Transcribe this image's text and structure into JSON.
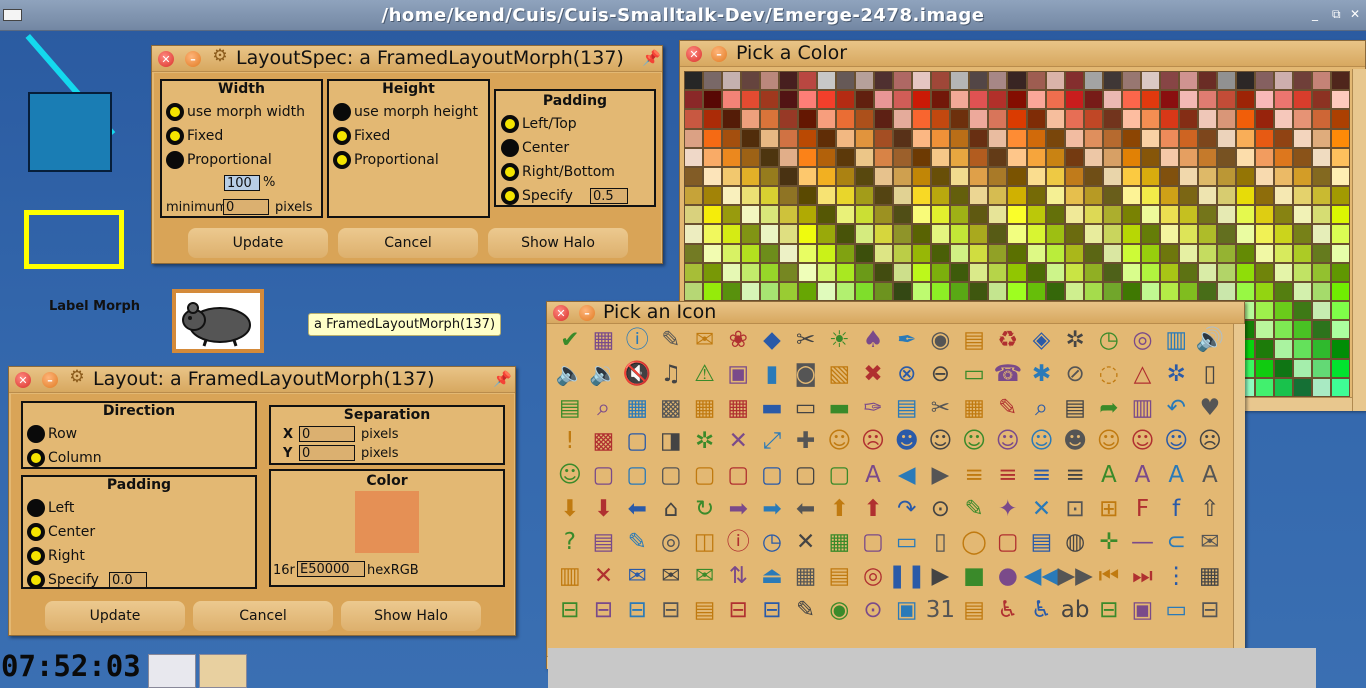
{
  "top_title": "/home/kend/Cuis/Cuis-Smalltalk-Dev/Emerge-2478.image",
  "desktop": {
    "label_morph": "Label Morph",
    "tooltip": "a FramedLayoutMorph(137)"
  },
  "layout_spec": {
    "title": "LayoutSpec: a FramedLayoutMorph(137)",
    "width": {
      "header": "Width",
      "options": [
        "use morph width",
        "Fixed",
        "Proportional"
      ],
      "selected": 2,
      "percent_value": "100",
      "percent_label": "%",
      "min_label": "minimum",
      "min_value": "0",
      "pixels_label": "pixels"
    },
    "height": {
      "header": "Height",
      "options": [
        "use morph height",
        "Fixed",
        "Proportional"
      ],
      "selected": 0
    },
    "padding": {
      "header": "Padding",
      "options": [
        "Left/Top",
        "Center",
        "Right/Bottom",
        "Specify"
      ],
      "selected": 1,
      "specify_value": "0.5"
    },
    "buttons": [
      "Update",
      "Cancel",
      "Show Halo"
    ]
  },
  "layout": {
    "title": "Layout: a FramedLayoutMorph(137)",
    "direction": {
      "header": "Direction",
      "options": [
        "Row",
        "Column"
      ],
      "selected": 0
    },
    "separation": {
      "header": "Separation",
      "x_label": "X",
      "x_value": "0",
      "y_label": "Y",
      "y_value": "0",
      "pixels_label": "pixels"
    },
    "padding": {
      "header": "Padding",
      "options": [
        "Left",
        "Center",
        "Right",
        "Specify"
      ],
      "selected": 0,
      "specify_value": "0.0"
    },
    "color": {
      "header": "Color",
      "prefix": "16r",
      "value": "E50000",
      "suffix": "hexRGB",
      "swatch": "#e59055"
    },
    "buttons": [
      "Update",
      "Cancel",
      "Show Halo"
    ]
  },
  "pick_color": {
    "title": "Pick a Color"
  },
  "pick_icon": {
    "title": "Pick an Icon",
    "icons": [
      "check-icon",
      "calculator-icon",
      "info-doc-icon",
      "edit-icon",
      "email-doc-icon",
      "badge-icon",
      "diamond-icon",
      "scissors-icon",
      "bell-icon",
      "cards-icon",
      "paintbrush-icon",
      "globe-icon",
      "clapper-icon",
      "trash-icon",
      "tag-icon",
      "gear-icon",
      "clock-icon",
      "disk-icon",
      "server-icon",
      "speaker-icon",
      "speaker-low-icon",
      "speaker-med-icon",
      "speaker-mute-icon",
      "music-icon",
      "warning-doc-icon",
      "package-icon",
      "book-icon",
      "camera-icon",
      "scanner-icon",
      "close-x-icon",
      "error-icon",
      "minus-icon",
      "monitor-icon",
      "phone-icon",
      "bug-icon",
      "stop-icon",
      "bulb-icon",
      "alert-icon",
      "gear2-icon"
    ]
  },
  "taskbar": {
    "clock": "07:52:03"
  }
}
